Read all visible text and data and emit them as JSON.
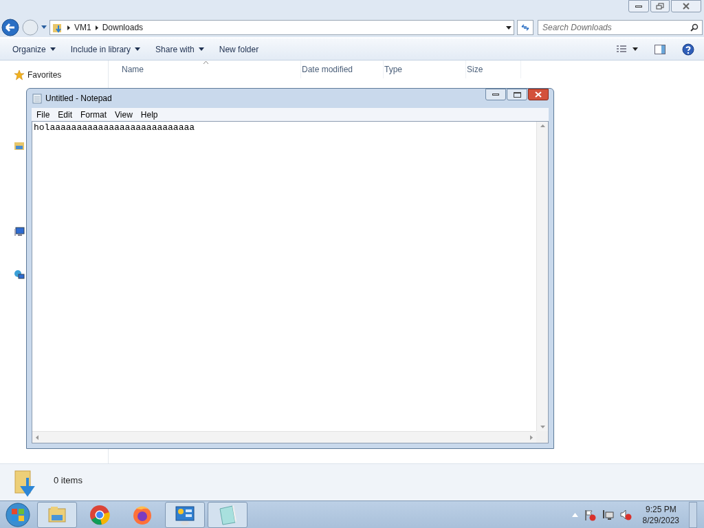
{
  "explorer": {
    "path": [
      "VM1",
      "Downloads"
    ],
    "search": {
      "placeholder": "Search Downloads"
    },
    "toolbar": [
      {
        "label": "Organize",
        "dropdown": true
      },
      {
        "label": "Include in library",
        "dropdown": true
      },
      {
        "label": "Share with",
        "dropdown": true
      },
      {
        "label": "New folder",
        "dropdown": false
      }
    ],
    "nav": {
      "favorites": "Favorites"
    },
    "columns": [
      "Name",
      "Date modified",
      "Type",
      "Size"
    ],
    "details": {
      "count": "0 items"
    }
  },
  "notepad": {
    "title": "Untitled - Notepad",
    "menu": [
      "File",
      "Edit",
      "Format",
      "View",
      "Help"
    ],
    "text": "holaaaaaaaaaaaaaaaaaaaaaaaaaaa"
  },
  "taskbar": {
    "apps": [
      {
        "kind": "explorer",
        "running": true
      },
      {
        "kind": "chrome",
        "running": false
      },
      {
        "kind": "firefox",
        "running": false
      },
      {
        "kind": "control-panel",
        "running": true
      },
      {
        "kind": "notepad",
        "running": true
      }
    ],
    "clock": {
      "time": "9:25 PM",
      "date": "8/29/2023"
    }
  }
}
